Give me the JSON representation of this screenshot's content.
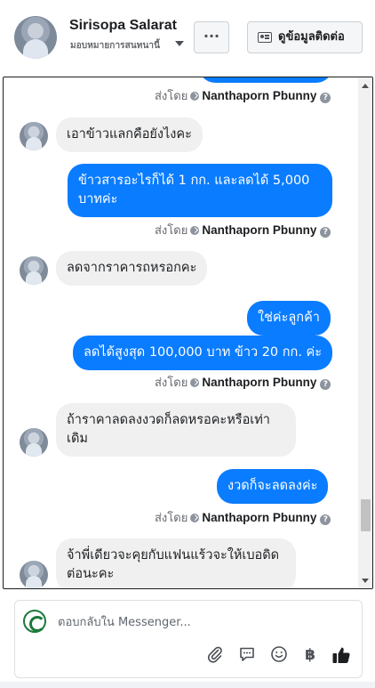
{
  "header": {
    "name": "Sirisopa Salarat",
    "subtitle": "มอบหมายการสนทนานี้",
    "more_label": "···",
    "contact_label": "ดูข้อมูลติดต่อ"
  },
  "sender_name": "Nanthaporn Pbunny",
  "sent_by_label": "ส่งโดย",
  "help_glyph": "?",
  "messages": [
    {
      "dir": "in",
      "text": "เอาข้าวแลกคือยังไงคะ"
    },
    {
      "dir": "out",
      "text": "ข้าวสารอะไรก็ได้ 1 กก. และลดได้ 5,000 บาทค่ะ"
    },
    {
      "dir": "in",
      "text": "ลดจากราคารถหรอกคะ"
    },
    {
      "dir": "out",
      "text": "ใช่ค่ะลูกค้า"
    },
    {
      "dir": "out",
      "text": "ลดได้สูงสุด 100,000 บาท ข้าว 20 กก. ค่ะ"
    },
    {
      "dir": "in",
      "text": "ถ้าราคาลดลงงวดก็ลดหรอคะหรือเท่าเดิม"
    },
    {
      "dir": "out",
      "text": "งวดก็จะลดลงค่ะ"
    },
    {
      "dir": "in",
      "text": "จ้าพี่เดียวจะคุยกับแฟนแร้วจะให้เบอดิดต่อนะคะ"
    }
  ],
  "composer": {
    "placeholder": "ตอบกลับใน Messenger...",
    "tools": [
      "paperclip-icon",
      "comment-icon",
      "emoji-icon",
      "baht-icon",
      "thumbs-up-icon"
    ],
    "baht_glyph": "฿"
  },
  "colors": {
    "outgoing": "#0a7cff",
    "incoming": "#f0f0f0",
    "brand_avatar": "#1a7a3a"
  }
}
